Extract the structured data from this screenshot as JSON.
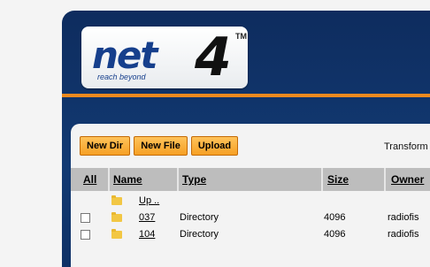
{
  "logo": {
    "brand": "net",
    "mark": "4",
    "tm": "TM",
    "tagline": "reach beyond"
  },
  "toolbar": {
    "new_dir": "New Dir",
    "new_file": "New File",
    "upload": "Upload",
    "transform": "Transform"
  },
  "table": {
    "headers": {
      "all": "All",
      "name": "Name",
      "type": "Type",
      "size": "Size",
      "owner": "Owner"
    },
    "up_label": "Up ..",
    "rows": [
      {
        "name": "037",
        "type": "Directory",
        "size": "4096",
        "owner": "radiofis"
      },
      {
        "name": "104",
        "type": "Directory",
        "size": "4096",
        "owner": "radiofis"
      }
    ]
  }
}
